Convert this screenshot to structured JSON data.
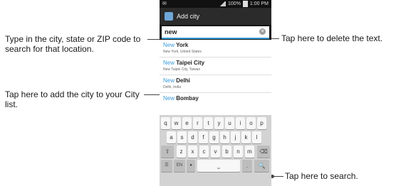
{
  "callouts": {
    "search_field": "Type in the city, state or ZIP code to search for that location.",
    "add_city": "Tap here to add the city to your City list.",
    "delete_text": "Tap here to delete the text.",
    "search_key": "Tap here to search."
  },
  "status_bar": {
    "time": "1:00 PM",
    "battery": "100%"
  },
  "title_bar": {
    "title": "Add city"
  },
  "search": {
    "value": "new"
  },
  "results": [
    {
      "highlight": "New",
      "rest": "York",
      "detail": "New York, United States"
    },
    {
      "highlight": "New",
      "rest": "Taipei City",
      "detail": "New Taipei City, Taiwan"
    },
    {
      "highlight": "New",
      "rest": "Delhi",
      "detail": "Delhi, India"
    },
    {
      "highlight": "New",
      "rest": "Bombay",
      "detail": ""
    }
  ],
  "keyboard": {
    "row1": [
      "q",
      "w",
      "e",
      "r",
      "t",
      "y",
      "u",
      "i",
      "o",
      "p"
    ],
    "row2": [
      "a",
      "s",
      "d",
      "f",
      "g",
      "h",
      "j",
      "k",
      "l"
    ],
    "row3": [
      "z",
      "x",
      "c",
      "v",
      "b",
      "n",
      "m"
    ],
    "lang": "EN"
  },
  "icons": {
    "app": "weather-app-icon",
    "clear": "clear-text-icon",
    "search_key": "magnifier-icon"
  }
}
